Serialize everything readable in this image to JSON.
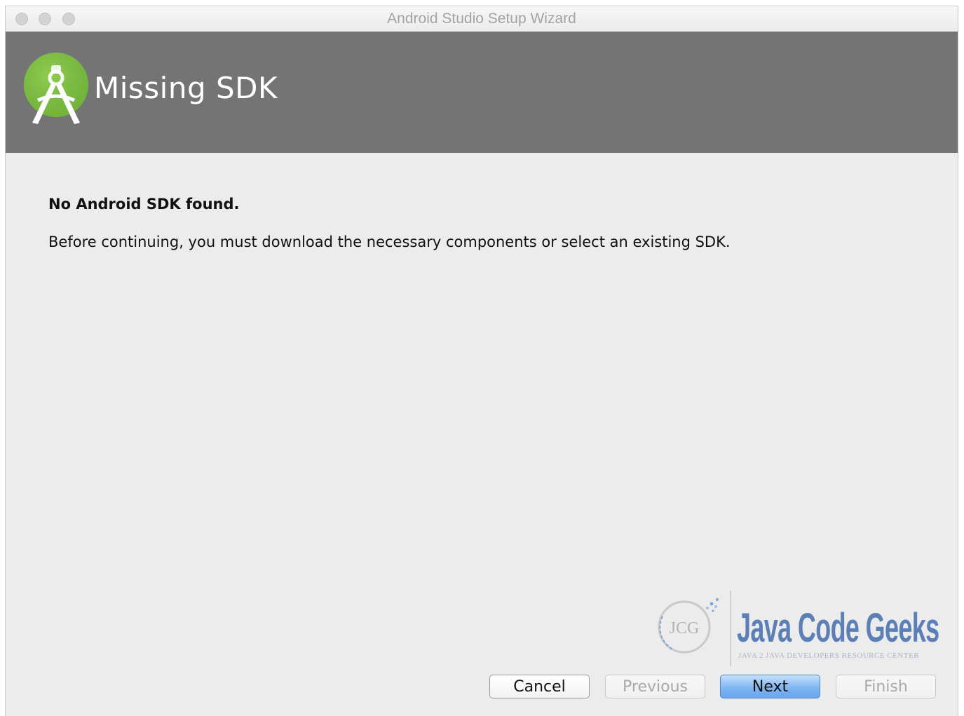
{
  "window": {
    "title": "Android Studio Setup Wizard"
  },
  "header": {
    "title": "Missing SDK",
    "logo_icon": "android-studio-logo-icon",
    "background_color": "#747474",
    "logo_color": "#7cbf42"
  },
  "main": {
    "headline": "No Android SDK found.",
    "description": "Before continuing, you must download the necessary components or select an existing SDK."
  },
  "watermark": {
    "badge": "JCG",
    "title": "Java Code Geeks",
    "subtitle": "JAVA 2 JAVA DEVELOPERS RESOURCE CENTER"
  },
  "buttons": {
    "cancel": "Cancel",
    "previous": "Previous",
    "next": "Next",
    "finish": "Finish"
  },
  "colors": {
    "primary_button": "#7fb6f3",
    "disabled_text": "#a8a8a8"
  }
}
